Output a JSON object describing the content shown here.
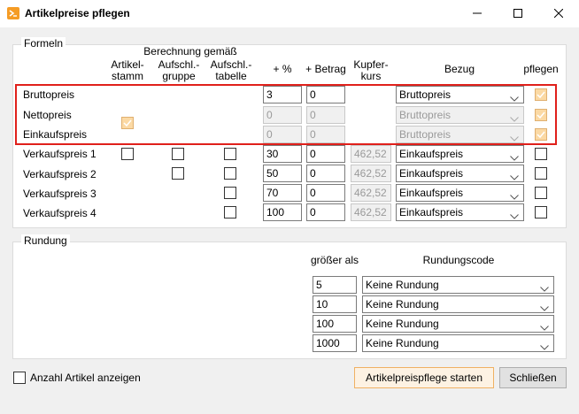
{
  "window": {
    "title": "Artikelpreise pflegen",
    "minimize_icon": "minimize-icon",
    "maximize_icon": "maximize-icon",
    "close_icon": "close-icon",
    "accent": "#f59c25"
  },
  "formeln": {
    "legend": "Formeln",
    "headers": {
      "berechnung": "Berechnung gemäß",
      "artikelstamm_1": "Artikel-",
      "artikelstamm_2": "stamm",
      "aufschlgruppe_1": "Aufschl.-",
      "aufschlgruppe_2": "gruppe",
      "aufschltabelle_1": "Aufschl.-",
      "aufschltabelle_2": "tabelle",
      "prozent": "+ %",
      "betrag": "+ Betrag",
      "kupferkurs_1": "Kupfer-",
      "kupferkurs_2": "kurs",
      "bezug": "Bezug",
      "pflegen": "pflegen"
    },
    "rows": [
      {
        "label": "Bruttopreis",
        "prozent": "3",
        "betrag": "0",
        "kupfer": "",
        "bezug": "Bruttopreis",
        "pflegen": true
      },
      {
        "label": "Nettopreis",
        "prozent": "0",
        "betrag": "0",
        "kupfer": "",
        "bezug": "Bruttopreis",
        "pflegen": true
      },
      {
        "label": "Einkaufspreis",
        "prozent": "0",
        "betrag": "0",
        "kupfer": "",
        "bezug": "Bruttopreis",
        "pflegen": true
      },
      {
        "label": "Verkaufspreis 1",
        "prozent": "30",
        "betrag": "0",
        "kupfer": "462,52",
        "bezug": "Einkaufspreis",
        "pflegen": false
      },
      {
        "label": "Verkaufspreis 2",
        "prozent": "50",
        "betrag": "0",
        "kupfer": "462,52",
        "bezug": "Einkaufspreis",
        "pflegen": false
      },
      {
        "label": "Verkaufspreis 3",
        "prozent": "70",
        "betrag": "0",
        "kupfer": "462,52",
        "bezug": "Einkaufspreis",
        "pflegen": false
      },
      {
        "label": "Verkaufspreis 4",
        "prozent": "100",
        "betrag": "0",
        "kupfer": "462,52",
        "bezug": "Einkaufspreis",
        "pflegen": false
      }
    ]
  },
  "rundung": {
    "legend": "Rundung",
    "header_groesser": "größer als",
    "header_code": "Rundungscode",
    "rows": [
      {
        "groesser": "5",
        "code": "Keine Rundung"
      },
      {
        "groesser": "10",
        "code": "Keine Rundung"
      },
      {
        "groesser": "100",
        "code": "Keine Rundung"
      },
      {
        "groesser": "1000",
        "code": "Keine Rundung"
      }
    ]
  },
  "footer": {
    "anzahl_label": "Anzahl Artikel anzeigen",
    "start_button": "Artikelpreispflege starten",
    "close_button": "Schließen"
  }
}
